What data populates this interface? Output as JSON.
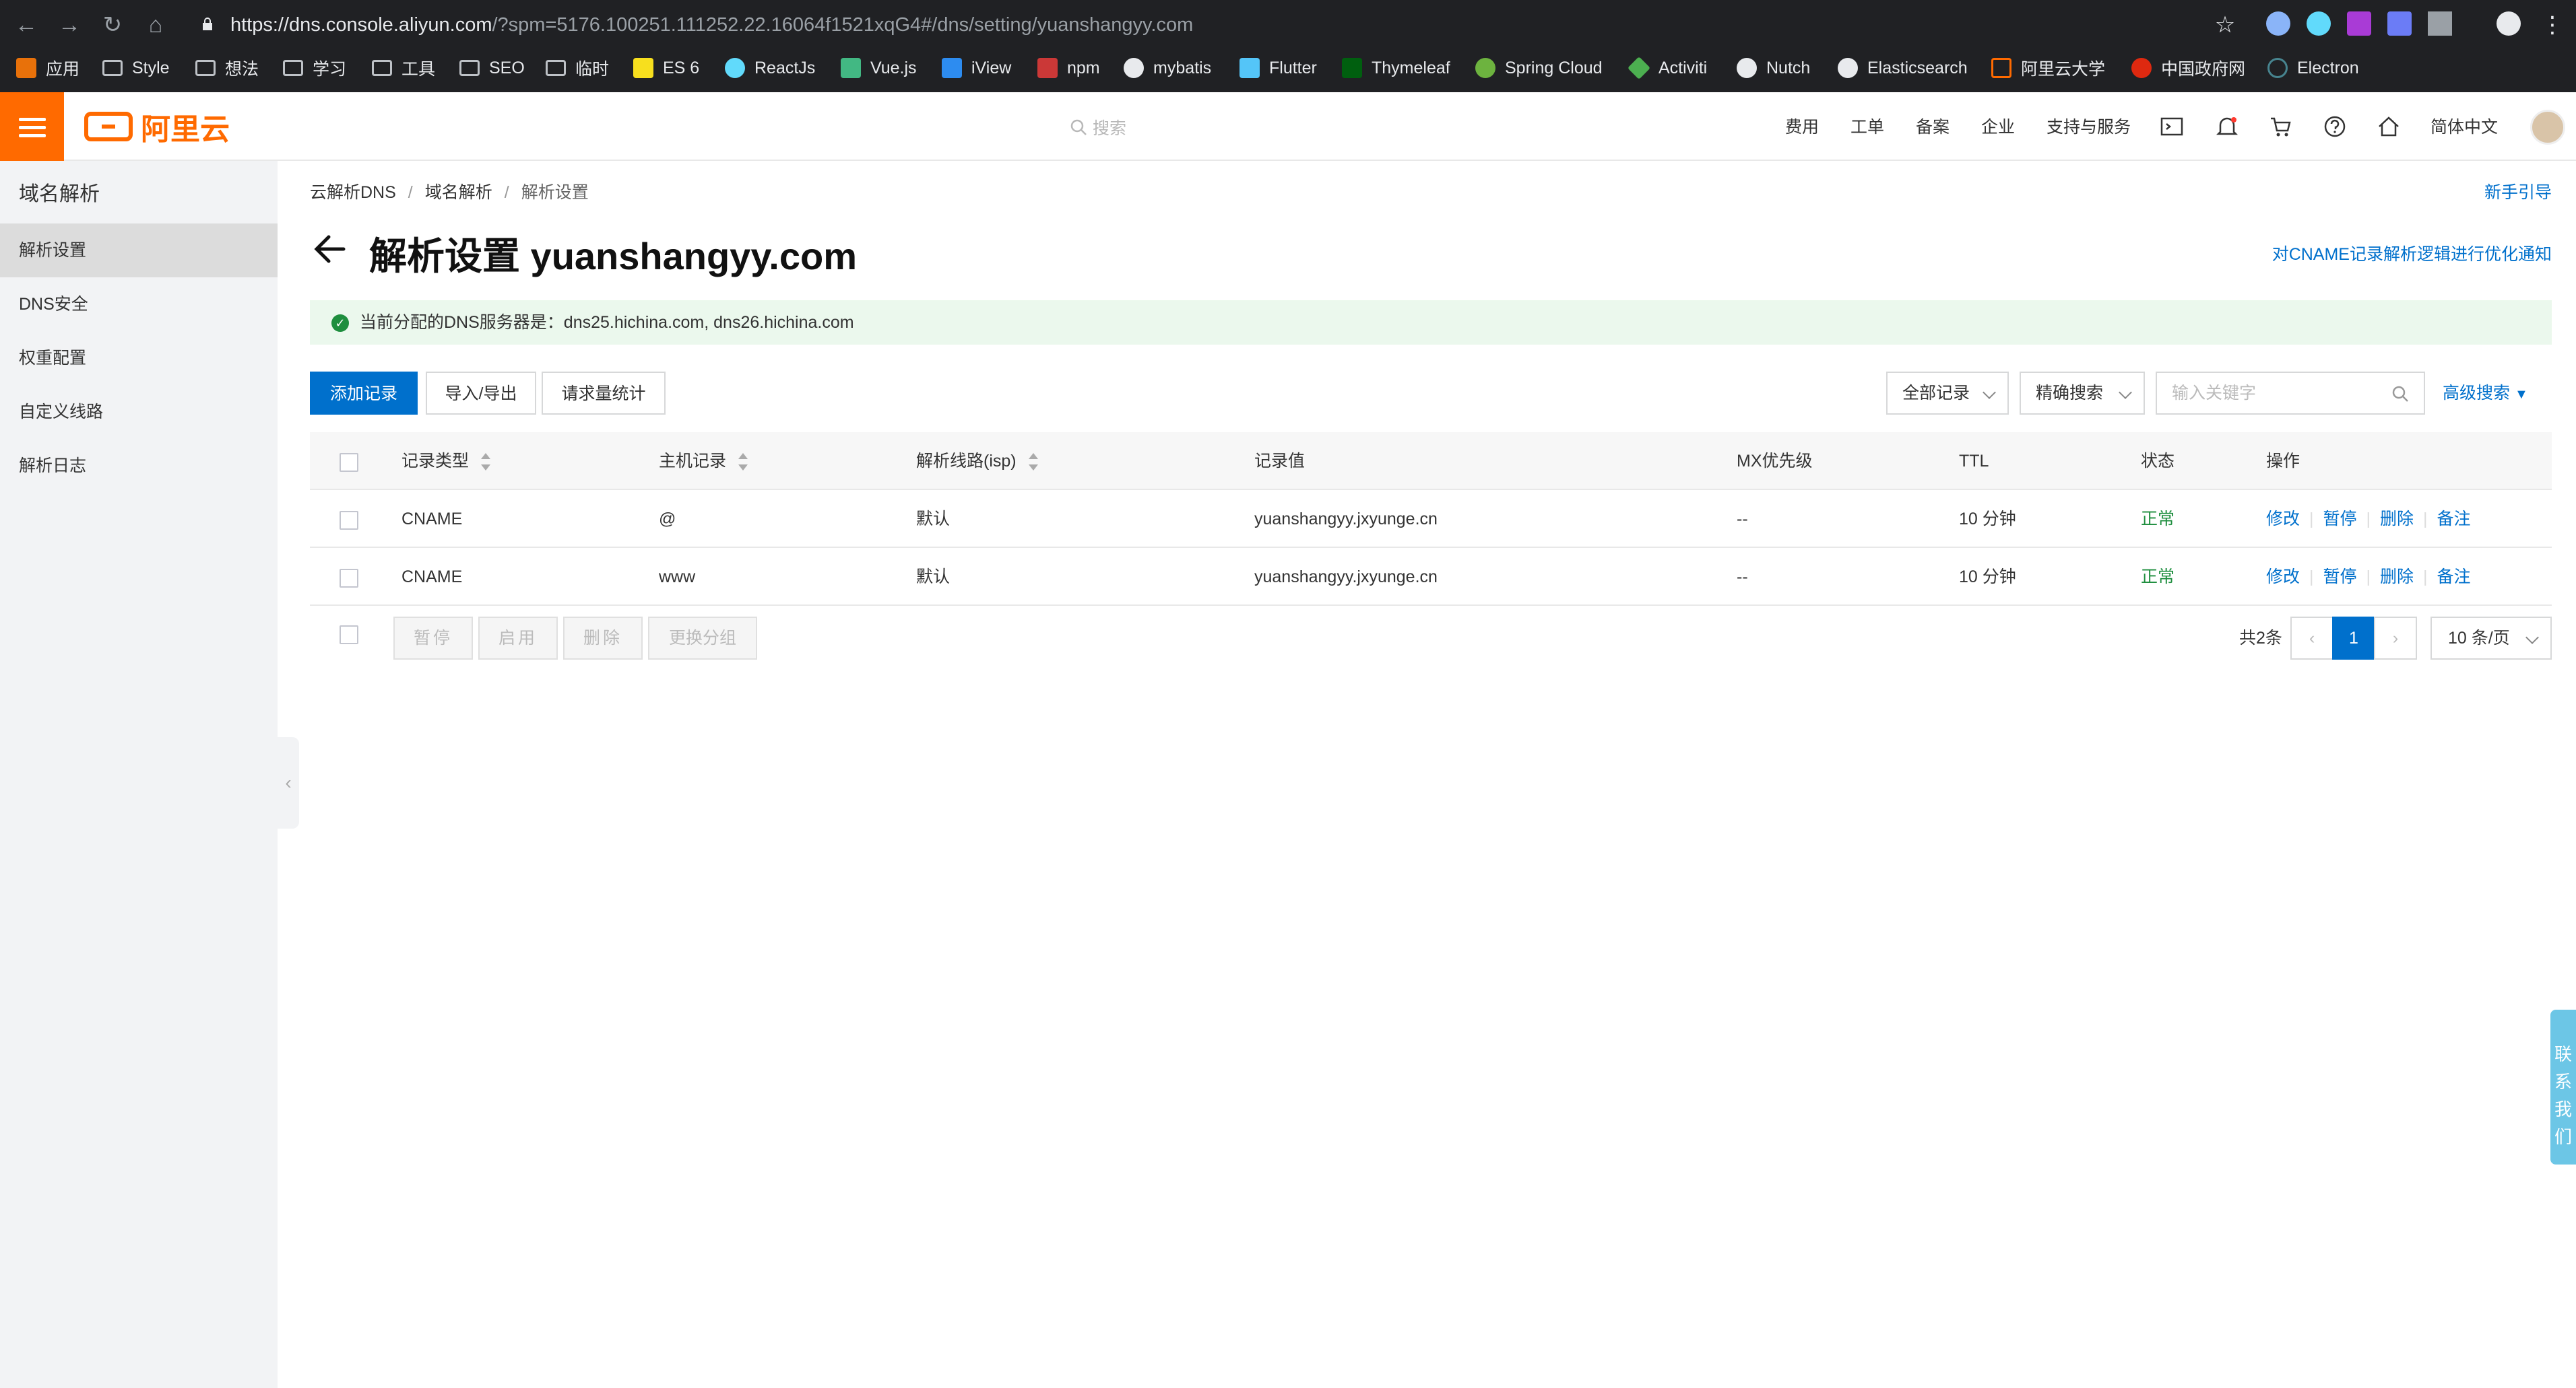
{
  "browser": {
    "url_host": "https://dns.console.aliyun.com",
    "url_rest": "/?spm=5176.100251.111252.22.16064f1521xqG4#/dns/setting/yuanshangyy.com",
    "bookmarks": [
      "应用",
      "Style",
      "想法",
      "学习",
      "工具",
      "SEO",
      "临时",
      "ES 6",
      "ReactJs",
      "Vue.js",
      "iView",
      "npm",
      "mybatis",
      "Flutter",
      "Thymeleaf",
      "Spring Cloud",
      "Activiti",
      "Nutch",
      "Elasticsearch",
      "阿里云大学",
      "中国政府网",
      "Electron"
    ]
  },
  "header": {
    "logo_text": "阿里云",
    "search_placeholder": "搜索",
    "links": [
      "费用",
      "工单",
      "备案",
      "企业",
      "支持与服务"
    ],
    "language": "简体中文"
  },
  "sidebar": {
    "title": "域名解析",
    "items": [
      "解析设置",
      "DNS安全",
      "权重配置",
      "自定义线路",
      "解析日志"
    ]
  },
  "breadcrumb": [
    "云解析DNS",
    "域名解析",
    "解析设置"
  ],
  "page": {
    "title": "解析设置 yuanshangyy.com",
    "helper_link": "新手引导",
    "notice_link": "对CNAME记录解析逻辑进行优化通知",
    "alert": "当前分配的DNS服务器是：dns25.hichina.com, dns26.hichina.com"
  },
  "toolbar": {
    "add": "添加记录",
    "import_export": "导入/导出",
    "stats": "请求量统计",
    "filter_all": "全部记录",
    "filter_precise": "精确搜索",
    "keyword_placeholder": "输入关键字",
    "advanced": "高级搜索"
  },
  "table": {
    "headers": [
      "记录类型",
      "主机记录",
      "解析线路(isp)",
      "记录值",
      "MX优先级",
      "TTL",
      "状态",
      "操作"
    ],
    "rows": [
      {
        "type": "CNAME",
        "host": "@",
        "line": "默认",
        "value": "yuanshangyy.jxyunge.cn",
        "mx": "--",
        "ttl": "10 分钟",
        "status": "正常"
      },
      {
        "type": "CNAME",
        "host": "www",
        "line": "默认",
        "value": "yuanshangyy.jxyunge.cn",
        "mx": "--",
        "ttl": "10 分钟",
        "status": "正常"
      }
    ],
    "actions": [
      "修改",
      "暂停",
      "删除",
      "备注"
    ]
  },
  "footer": {
    "batch": [
      "暂停",
      "启用",
      "删除",
      "更换分组"
    ],
    "total": "共2条",
    "current_page": "1",
    "page_size": "10 条/页"
  },
  "contact": "联系我们",
  "colors": {
    "brand": "#ff6a00",
    "primary": "#0070cc",
    "success": "#1e8e3e"
  }
}
